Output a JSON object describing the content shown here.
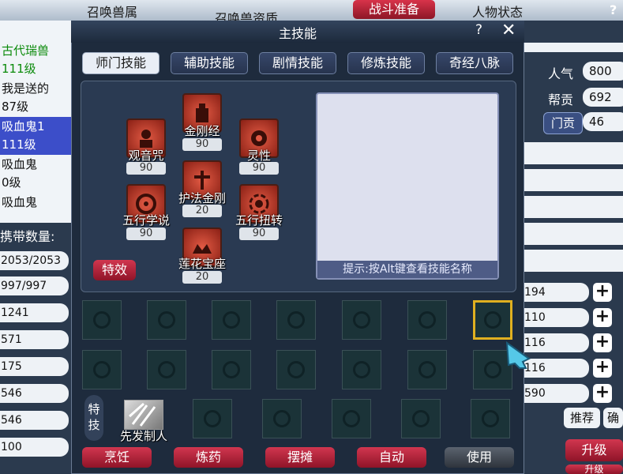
{
  "top": {
    "summon_attr": "召唤兽属",
    "summon_quality": "召唤兽资质",
    "battle_prep": "战斗准备",
    "char_status": "人物状态",
    "help": "?"
  },
  "left": {
    "items": [
      {
        "text": "古代瑞兽",
        "state": "green"
      },
      {
        "text": "111级",
        "state": "green"
      },
      {
        "text": "我是送的",
        "state": "normal"
      },
      {
        "text": "87级",
        "state": "normal"
      },
      {
        "text": "吸血鬼1",
        "state": "selected"
      },
      {
        "text": "111级",
        "state": "selected"
      },
      {
        "text": "吸血鬼",
        "state": "normal"
      },
      {
        "text": "0级",
        "state": "normal"
      },
      {
        "text": "吸血鬼",
        "state": "normal"
      }
    ],
    "carry_label": "携带数量:",
    "stats": [
      "2053/2053",
      "997/997",
      "1241",
      "571",
      "175",
      "546",
      "546",
      "100"
    ]
  },
  "right": {
    "popularity_label": "人气",
    "popularity": "800",
    "gang_label": "帮贡",
    "gang": "692",
    "sect_label": "门贡",
    "sect": "46",
    "stats": [
      "194",
      "110",
      "116",
      "116",
      "590"
    ],
    "plus": "+",
    "recommend": "推荐",
    "confirm": "确",
    "upgrade": "升级",
    "upgrade2": "升级"
  },
  "window": {
    "title": "主技能",
    "help": "?",
    "close": "✕",
    "tabs": [
      "师门技能",
      "辅助技能",
      "剧情技能",
      "修炼技能",
      "奇经八脉"
    ],
    "skills": [
      {
        "name": "金刚经",
        "level": "90"
      },
      {
        "name": "观音咒",
        "level": "90"
      },
      {
        "name": "灵性",
        "level": "90"
      },
      {
        "name": "护法金刚",
        "level": "20"
      },
      {
        "name": "五行学说",
        "level": "90"
      },
      {
        "name": "五行扭转",
        "level": "90"
      },
      {
        "name": "莲花宝座",
        "level": "20"
      }
    ],
    "effect_btn": "特效",
    "hint": "提示:按Alt键查看技能名称",
    "tech_label": "特技",
    "tech_skill": "先发制人",
    "buttons": [
      "烹饪",
      "炼药",
      "摆摊",
      "自动"
    ],
    "use": "使用"
  },
  "colors": {
    "accent_red": "#b8203a",
    "selected_blue": "#3c4ec9",
    "highlight_gold": "#e0b020"
  }
}
